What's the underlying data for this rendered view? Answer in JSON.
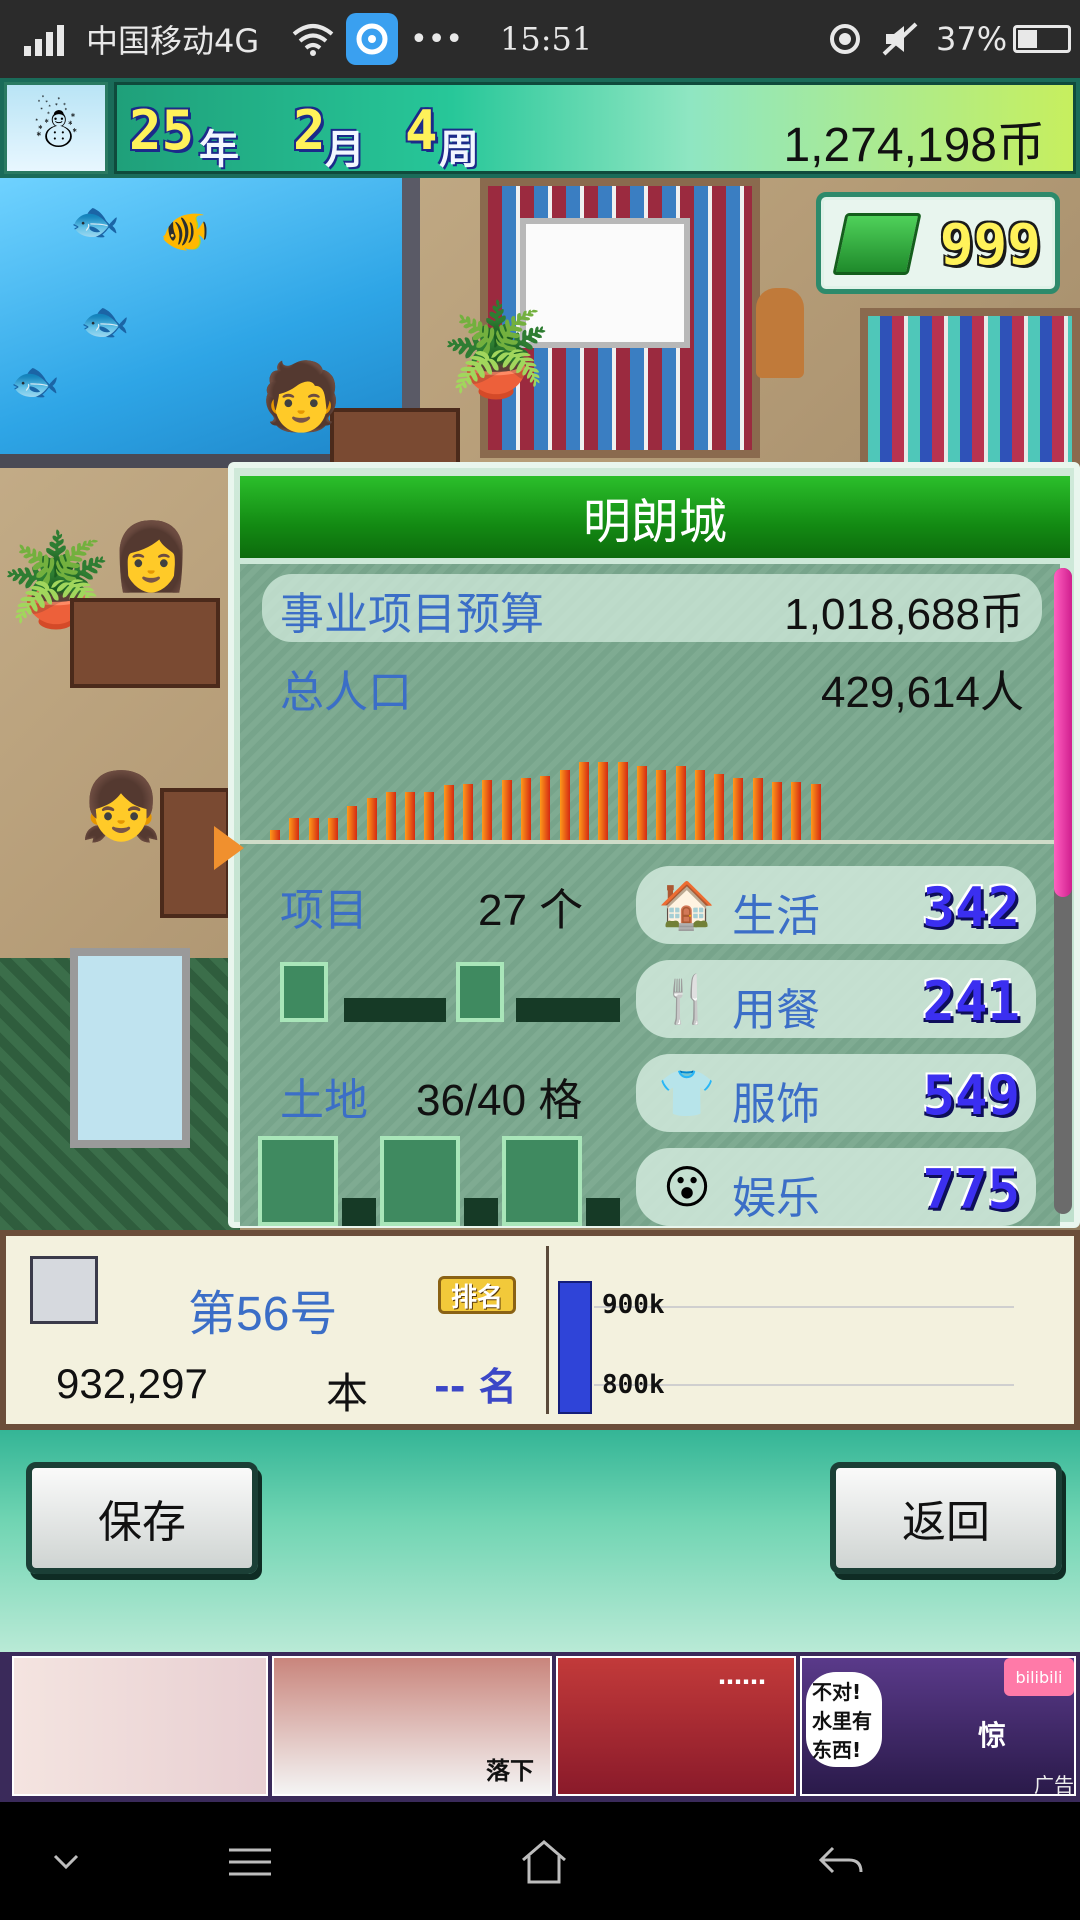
{
  "status_bar": {
    "carrier": "中国移动4G",
    "dots": "•••",
    "time": "15:51",
    "battery": "37%",
    "battery_level": 0.37,
    "icons": [
      "signal-icon",
      "wifi-icon",
      "app-notification-icon",
      "location-icon",
      "mute-icon",
      "battery-icon"
    ]
  },
  "header": {
    "year": "25",
    "year_unit": "年",
    "month": "2",
    "month_unit": "月",
    "week": "4",
    "week_unit": "周",
    "money": "1,274,198币",
    "avatar_icon": "snowman-icon"
  },
  "gems": {
    "count": "999",
    "icon": "gem-stack-icon"
  },
  "panel": {
    "title": "明朗城",
    "budget_label": "事业项目预算",
    "budget_value": "1,018,688币",
    "population_label": "总人口",
    "population_value": "429,614人",
    "population_history": [
      10,
      22,
      22,
      22,
      34,
      42,
      48,
      48,
      48,
      55,
      56,
      60,
      60,
      62,
      64,
      70,
      78,
      78,
      78,
      74,
      70,
      74,
      70,
      66,
      62,
      62,
      58,
      58,
      56
    ],
    "scroll_position": 0.51,
    "projects_label": "项目",
    "projects_value": "27 个",
    "land_label": "土地",
    "land_value": "36/40 格",
    "categories": [
      {
        "label": "生活",
        "value": "342",
        "icon": "house-icon"
      },
      {
        "label": "用餐",
        "value": "241",
        "icon": "fork-spoon-icon"
      },
      {
        "label": "服饰",
        "value": "549",
        "icon": "shirt-icon"
      },
      {
        "label": "娱乐",
        "value": "775",
        "icon": "smiley-icon"
      }
    ]
  },
  "ranking": {
    "rank_title": "第56号",
    "badge": "排名",
    "score": "932,297",
    "score_unit": "本",
    "place_prefix": "--",
    "place_suffix": "名",
    "chart_ticks": [
      "900k",
      "800k"
    ],
    "chart_bar_value": 932297
  },
  "actions": {
    "save_label": "保存",
    "back_label": "返回"
  },
  "ad": {
    "captions": [
      "落下",
      "不对!水里有东西!",
      "惊",
      "……"
    ],
    "logo": "bilibili",
    "tag": "广告"
  },
  "nav": {
    "icons": [
      "chevron-down-icon",
      "menu-icon",
      "home-icon",
      "back-arrow-icon"
    ]
  },
  "colors": {
    "accent_green": "#138a13",
    "label_blue": "#3b6ec7",
    "bar_orange": "#d42a12",
    "scroll_pink": "#d01e8e"
  }
}
